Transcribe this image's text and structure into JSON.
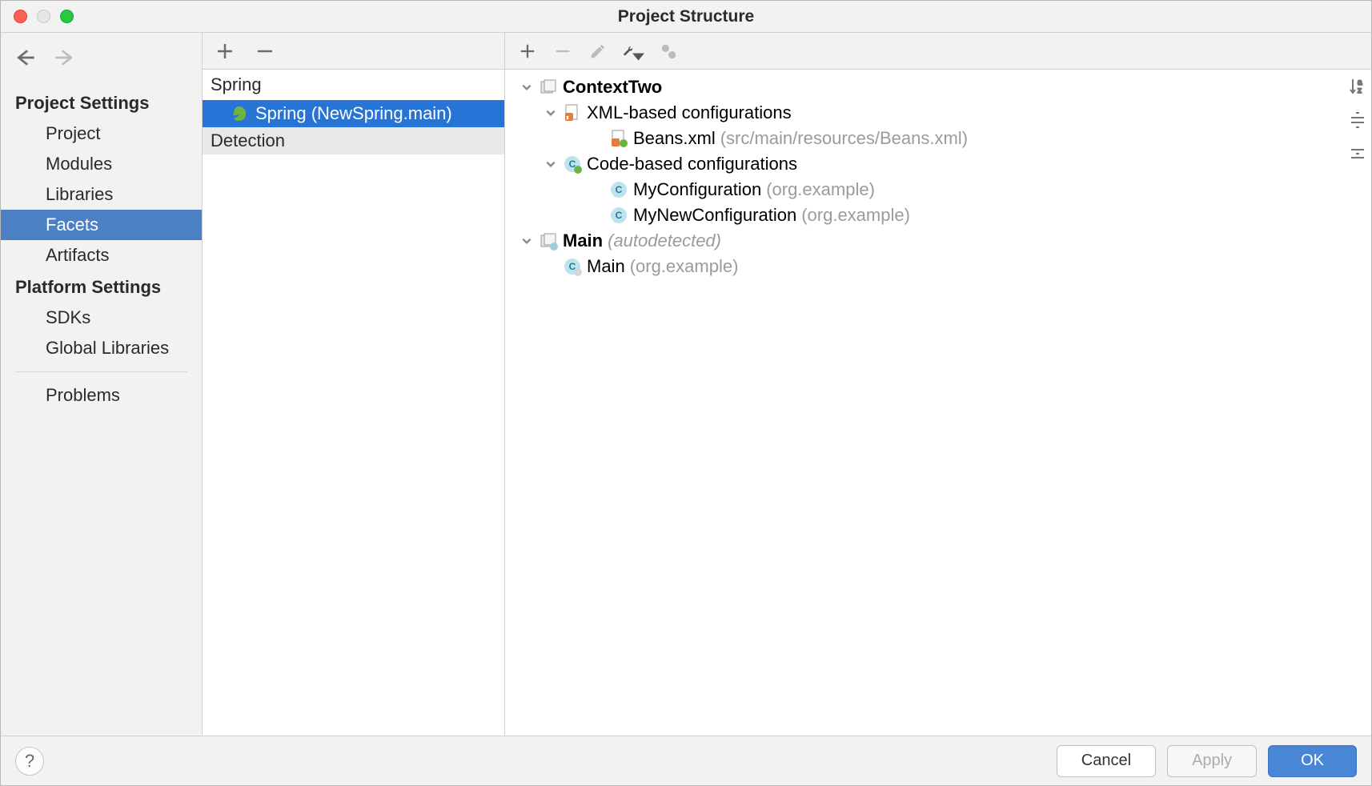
{
  "title": "Project Structure",
  "sidebar": {
    "projectHeader": "Project Settings",
    "platformHeader": "Platform Settings",
    "project": "Project",
    "modules": "Modules",
    "libraries": "Libraries",
    "facets": "Facets",
    "artifacts": "Artifacts",
    "sdks": "SDKs",
    "globalLibraries": "Global Libraries",
    "problems": "Problems"
  },
  "mid": {
    "groupSpring": "Spring",
    "springItem": "Spring (NewSpring.main)",
    "detection": "Detection"
  },
  "tree": {
    "contextTwo": "ContextTwo",
    "xmlGroup": "XML-based configurations",
    "beansXml": "Beans.xml",
    "beansXmlPath": "(src/main/resources/Beans.xml)",
    "codeGroup": "Code-based configurations",
    "myConfig": "MyConfiguration",
    "myConfigPkg": "(org.example)",
    "myNewConfig": "MyNewConfiguration",
    "myNewConfigPkg": "(org.example)",
    "mainCtx": "Main",
    "mainCtxHint": "(autodetected)",
    "mainClass": "Main",
    "mainClassPkg": "(org.example)"
  },
  "footer": {
    "cancel": "Cancel",
    "apply": "Apply",
    "ok": "OK"
  }
}
